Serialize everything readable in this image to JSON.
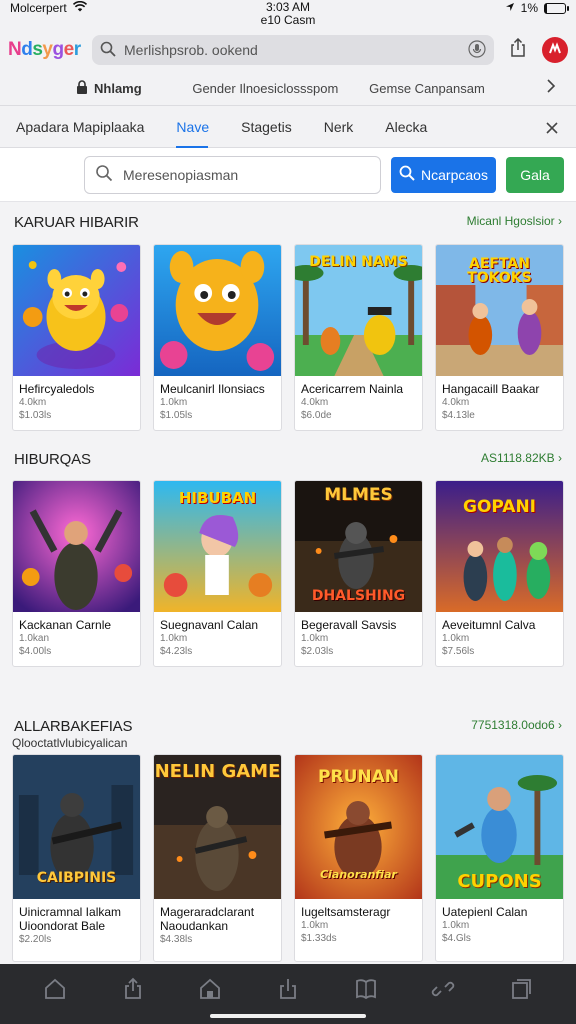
{
  "status": {
    "carrier": "Molcerpert",
    "time": "3:03 AM",
    "subtitle": "e10 Casm",
    "battery": "1%",
    "battery_level": 0.12
  },
  "browser": {
    "logo": [
      "N",
      "d",
      "s",
      "y",
      "g",
      "e",
      "r"
    ],
    "url": "Merlishpsrob. ookend"
  },
  "site_bar": {
    "lock_label": "Nhlamg",
    "links": [
      "Gender Ilnoesiclossspom",
      "Gemse Canpansam"
    ]
  },
  "tabs": {
    "items": [
      "Apadara Mapiplaaka",
      "Nave",
      "Stagetis",
      "Nerk",
      "Alecka"
    ],
    "active_index": 1
  },
  "search": {
    "placeholder": "Meresenopiasman",
    "primary_button": "Ncarpcaos",
    "secondary_button": "Gala"
  },
  "sections": [
    {
      "title": "KARUAR HIBARIR",
      "link": "Micanl Hgoslsior",
      "subtitle": "",
      "cards": [
        {
          "title": "Hefircyaledols",
          "line2": "",
          "meta1": "4.0km",
          "meta2": "$1.03ls",
          "art": ""
        },
        {
          "title": "Meulcanirl Ilonsiacs",
          "line2": "",
          "meta1": "1.0km",
          "meta2": "$1.05ls",
          "art": ""
        },
        {
          "title": "Acericarrem Nainla",
          "line2": "",
          "meta1": "4.0km",
          "meta2": "$6.0de",
          "art": "DELIN NAMS"
        },
        {
          "title": "Hangacaill Baakar",
          "line2": "",
          "meta1": "4.0km",
          "meta2": "$4.13le",
          "art": "AEFTAN TOKOKS"
        }
      ]
    },
    {
      "title": "HIBURQAS",
      "link": "AS1118.82KB",
      "subtitle": "",
      "cards": [
        {
          "title": "Kackanan Carnle",
          "line2": "",
          "meta1": "1.0kan",
          "meta2": "$4.00ls",
          "art": ""
        },
        {
          "title": "Suegnavanl Calan",
          "line2": "",
          "meta1": "1.0km",
          "meta2": "$4.23ls",
          "art": "HIBUBAN"
        },
        {
          "title": "Begeravall Savsis",
          "line2": "",
          "meta1": "1.0km",
          "meta2": "$2.03ls",
          "art": "MLMES",
          "art2": "DHALSHING"
        },
        {
          "title": "Aeveitumnl Calva",
          "line2": "",
          "meta1": "1.0km",
          "meta2": "$7.56ls",
          "art": "GOPANI"
        }
      ]
    },
    {
      "title": "ALLARBAKEFIAS",
      "link": "7751318.0odo6",
      "subtitle": "Qlooctatlvlubicyalican",
      "cards": [
        {
          "title": "Uinicramnal Ialkam",
          "line2": "Uioondorat Bale",
          "meta1": "",
          "meta2": "$2.20ls",
          "art": "CAIBPINIS"
        },
        {
          "title": "Mageraradclarant",
          "line2": "Naoudankan",
          "meta1": "",
          "meta2": "$4.38ls",
          "art": "NELIN GAME"
        },
        {
          "title": "Iugeltsamsteragr",
          "line2": "",
          "meta1": "1.0km",
          "meta2": "$1.33ds",
          "art": "PRUNAN",
          "art2": "Cianoranfiar"
        },
        {
          "title": "Uatepienl Calan",
          "line2": "",
          "meta1": "1.0km",
          "meta2": "$4.Gls",
          "art": "CUPONS"
        }
      ]
    }
  ],
  "colors": {
    "accent_blue": "#1a73e8",
    "accent_green": "#34a853",
    "link_green": "#2e7d32",
    "avatar_red": "#d8202c"
  },
  "icons": {
    "bottom_nav": [
      "home-icon",
      "share-icon",
      "home-icon",
      "share-icon",
      "book-icon",
      "link-icon",
      "tabs-icon"
    ]
  }
}
